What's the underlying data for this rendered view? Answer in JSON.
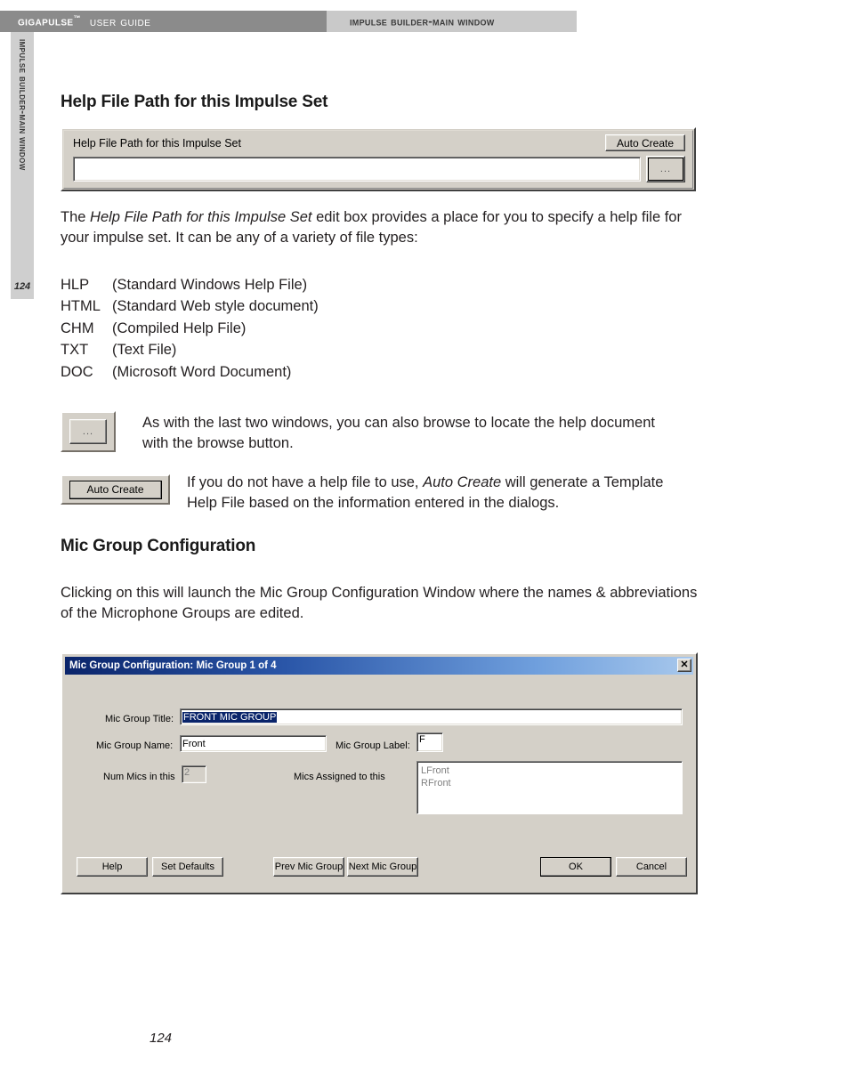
{
  "header": {
    "brand": "GigaPulse",
    "trademark": "™",
    "guide_label": "User Guide",
    "chapter_label": "Impulse Builder-Main Window",
    "bar_left_color": "#8b8b8b",
    "bar_right_color": "#c9c9c9"
  },
  "side_tab": {
    "label": "Impulse Builder-Main Window",
    "page_number": "124"
  },
  "sections": {
    "help_file_path": {
      "heading": "Help File Path for this Impulse Set",
      "paragraph_lead": "The ",
      "paragraph_italic": "Help File Path for this Impulse Set",
      "paragraph_rest": " edit box provides a place for you to specify a help file for your impulse set.  It can be any of a variety of file types:",
      "file_types": [
        {
          "ext": "HLP",
          "desc": "(Standard Windows Help File)"
        },
        {
          "ext": "HTML",
          "desc": "(Standard Web style document)"
        },
        {
          "ext": "CHM",
          "desc": "(Compiled Help File)"
        },
        {
          "ext": "TXT",
          "desc": "(Text File)"
        },
        {
          "ext": "DOC",
          "desc": "(Microsoft Word Document)"
        }
      ]
    },
    "mic_group": {
      "heading": "Mic Group Configuration",
      "paragraph": "Clicking on this will launch the Mic Group Configuration Window where the names & abbreviations of the Microphone Groups are edited."
    }
  },
  "figure_help_path": {
    "caption": "Help File Path for this Impulse Set",
    "auto_create_label": "Auto Create",
    "path_value": "",
    "browse_label": "..."
  },
  "callouts": [
    {
      "button_label": "...",
      "text": "As with the last two windows, you can also browse to locate the help document with the browse button."
    },
    {
      "button_label": "Auto Create",
      "text_before": "If you do not have a help file to use, ",
      "text_italic": "Auto Create",
      "text_after": " will generate a Template Help File based on the information entered in the dialogs."
    }
  ],
  "mic_dialog": {
    "title": "Mic Group Configuration: Mic Group 1 of 4",
    "close_glyph": "✕",
    "titlebar_color_start": "#0a246a",
    "titlebar_color_end": "#a8c8ec",
    "fields": {
      "title_label": "Mic Group Title:",
      "title_value": "FRONT MIC GROUP",
      "name_label": "Mic Group Name:",
      "name_value": "Front",
      "label_label": "Mic Group Label:",
      "label_value": "F",
      "num_mics_label": "Num Mics in this",
      "num_mics_value": "2",
      "assigned_label": "Mics Assigned to this",
      "assigned_items": [
        "LFront",
        "RFront"
      ]
    },
    "buttons": {
      "help": "Help",
      "set_defaults": "Set Defaults",
      "prev": "Prev Mic Group",
      "next": "Next Mic Group",
      "ok": "OK",
      "cancel": "Cancel"
    }
  },
  "footer": {
    "page_number": "124"
  }
}
